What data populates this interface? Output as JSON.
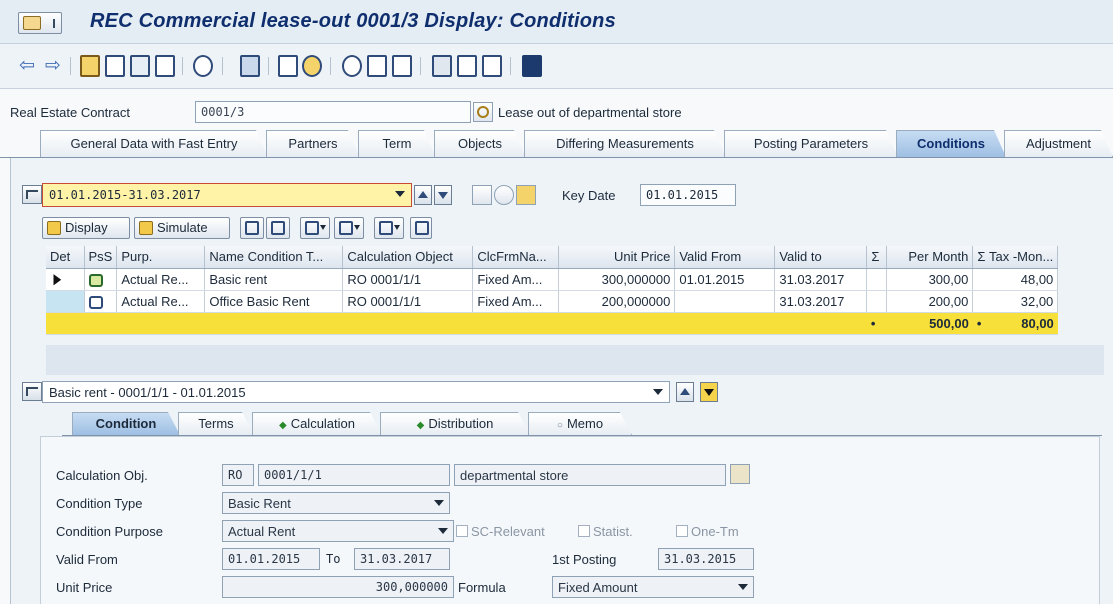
{
  "window": {
    "title": "REC Commercial lease-out 0001/3 Display: Conditions"
  },
  "header": {
    "contract_label": "Real Estate Contract",
    "contract_value": "0001/3",
    "contract_desc": "Lease out of departmental store"
  },
  "tabs": [
    "General Data with Fast Entry",
    "Partners",
    "Term",
    "Objects",
    "Differing Measurements",
    "Posting Parameters",
    "Conditions",
    "Adjustment"
  ],
  "active_tab": "Conditions",
  "period": {
    "value": "01.01.2015-31.03.2017",
    "key_date_label": "Key Date",
    "key_date": "01.01.2015"
  },
  "actions": {
    "display": "Display",
    "simulate": "Simulate"
  },
  "grid": {
    "columns": [
      "Det",
      "PsS",
      "Purp.",
      "Name Condition T...",
      "Calculation Object",
      "ClcFrmNa...",
      "Unit Price",
      "Valid From",
      "Valid to",
      "Σ",
      "Per Month",
      "Σ Tax -Mon..."
    ],
    "rows": [
      {
        "purpose": "Actual Re...",
        "name": "Basic rent",
        "calc_object": "RO 0001/1/1",
        "calc_formula": "Fixed Am...",
        "unit_price": "300,000000",
        "valid_from": "01.01.2015",
        "valid_to": "31.03.2017",
        "per_month": "300,00",
        "tax_month": "48,00"
      },
      {
        "purpose": "Actual Re...",
        "name": "Office Basic Rent",
        "calc_object": "RO 0001/1/1",
        "calc_formula": "Fixed Am...",
        "unit_price": "200,000000",
        "valid_from": "",
        "valid_to": "31.03.2017",
        "per_month": "200,00",
        "tax_month": "32,00"
      }
    ],
    "totals": {
      "per_month": "500,00",
      "tax_month": "80,00",
      "dot": "•"
    }
  },
  "condition_selector": "Basic rent - 0001/1/1 - 01.01.2015",
  "sub_tabs": [
    "Condition",
    "Terms",
    "Calculation",
    "Distribution",
    "Memo"
  ],
  "form": {
    "calc_obj_label": "Calculation Obj.",
    "calc_obj_type": "RO",
    "calc_obj_id": "0001/1/1",
    "calc_obj_desc": "departmental store",
    "cond_type_label": "Condition Type",
    "cond_type_value": "Basic Rent",
    "cond_purpose_label": "Condition Purpose",
    "cond_purpose_value": "Actual Rent",
    "sc_relevant": "SC-Relevant",
    "statist": "Statist.",
    "one_tm": "One-Tm",
    "valid_from_label": "Valid From",
    "valid_from": "01.01.2015",
    "to_label": "To",
    "valid_to": "31.03.2017",
    "first_posting_label": "1st Posting",
    "first_posting": "31.03.2015",
    "unit_price_label": "Unit Price",
    "unit_price": "300,000000",
    "formula_label": "Formula",
    "formula_value": "Fixed Amount"
  }
}
